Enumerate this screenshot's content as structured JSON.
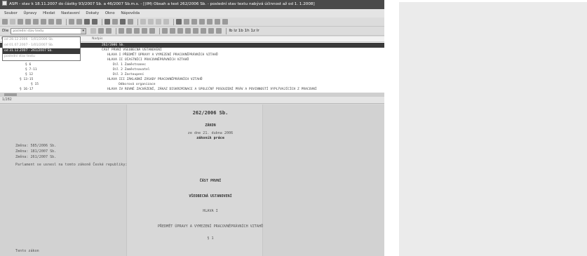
{
  "window": {
    "title": "ASPI - stav k 18.11.2007 do částky 93/2007 Sb. a 46/2007 Sb.m.s. - [(IM) Obsah a text 262/2006 Sb. - poslední stav textu nabývá účinnost až od 1. 1.2008]"
  },
  "menu": [
    "Soubor",
    "Úpravy",
    "Hledat",
    "Nastavení",
    "Dokaty",
    "Okno",
    "Nápověda"
  ],
  "toolbar2": {
    "version_label": "Dle",
    "version_combo_value": "poslední stav textu",
    "right_glyphs": "Ib Iz 1b 1h 1z Ir"
  },
  "toc": {
    "header_col1": "Paragraf",
    "header_col2": "Nadpis",
    "rows": [
      {
        "c1": "",
        "c2": "262/2006 Sb.",
        "indent": 0,
        "selected": true
      },
      {
        "c1": "",
        "c2": "ČÁST PRVNÍ VŠEOBECNÁ USTANOVENÍ",
        "indent": 0,
        "selected": false
      },
      {
        "c1": "",
        "c2": "HLAVA I PŘEDMĚT ÚPRAVY A VYMEZENÍ PRACOVNĚPRÁVNÍCH VZTAHŮ",
        "indent": 8,
        "selected": false
      },
      {
        "c1": "§ 6-12",
        "c2": "HLAVA II ÚČASTNÍCI PRACOVNĚPRÁVNÍCH VZTAHŮ",
        "indent": 8,
        "selected": false
      },
      {
        "c1": "§ 6",
        "c2": "Díl 1 Zaměstnanec",
        "indent": 16,
        "selected": false
      },
      {
        "c1": "§ 7-11",
        "c2": "Díl 2 Zaměstnavatel",
        "indent": 16,
        "selected": false
      },
      {
        "c1": "§ 12",
        "c2": "Díl 3 Zastoupení",
        "indent": 16,
        "selected": false
      },
      {
        "c1": "§ 13-15",
        "c2": "HLAVA III ZÁKLADNÍ ZÁSADY PRACOVNĚPRÁVNÍCH VZTAHŮ",
        "indent": 8,
        "selected": false
      },
      {
        "c1": "§ 15",
        "c2": "Odborová organizace",
        "indent": 24,
        "selected": false
      },
      {
        "c1": "§ 16-17",
        "c2": "HLAVA IV ROVNÉ ZACHÁZENÍ, ZÁKAZ DISKRIMINACE A SPOLEČNÝ POSOUZENÍ PRÁV A POVINNOSTÍ VYPLÝVAJÍCÍCH Z PRACOVNÍ",
        "indent": 8,
        "selected": false
      }
    ]
  },
  "dropdown": {
    "options": [
      {
        "label": "od 28.12.2006 - 1/01/2006 Sb.",
        "selected": false
      },
      {
        "label": "od 01.07.2007 - 1/01/2007 Sb.",
        "selected": false
      },
      {
        "label": "od 31.12.2007 - 261/2007 Sb.",
        "selected": true
      },
      {
        "label": "poslední stav textu",
        "selected": false
      }
    ]
  },
  "status": {
    "text": "1/282"
  },
  "document": {
    "number": "262/2006 Sb.",
    "kind": "ZÁKON",
    "date": "ze dne 21. dubna 2006",
    "subject": "zákoník práce",
    "changes": [
      {
        "label": "Změna:",
        "link": "585/2006 Sb."
      },
      {
        "label": "Změna:",
        "link": "181/2007 Sb."
      },
      {
        "label": "Změna:",
        "link": "261/2007 Sb."
      }
    ],
    "preamble": "Parlament se usnesl na tomto zákoně České republiky:",
    "part": "ČÁST PRVNÍ",
    "part_title": "VŠEOBECNÁ USTANOVENÍ",
    "chapter": "HLAVA I",
    "chapter_title": "PŘEDMĚT ÚPRAVY A VYMEZENÍ PRACOVNĚPRÁVNÍCH VZTAHŮ",
    "section": "§ 1",
    "footer_text": "Tento zákon"
  }
}
